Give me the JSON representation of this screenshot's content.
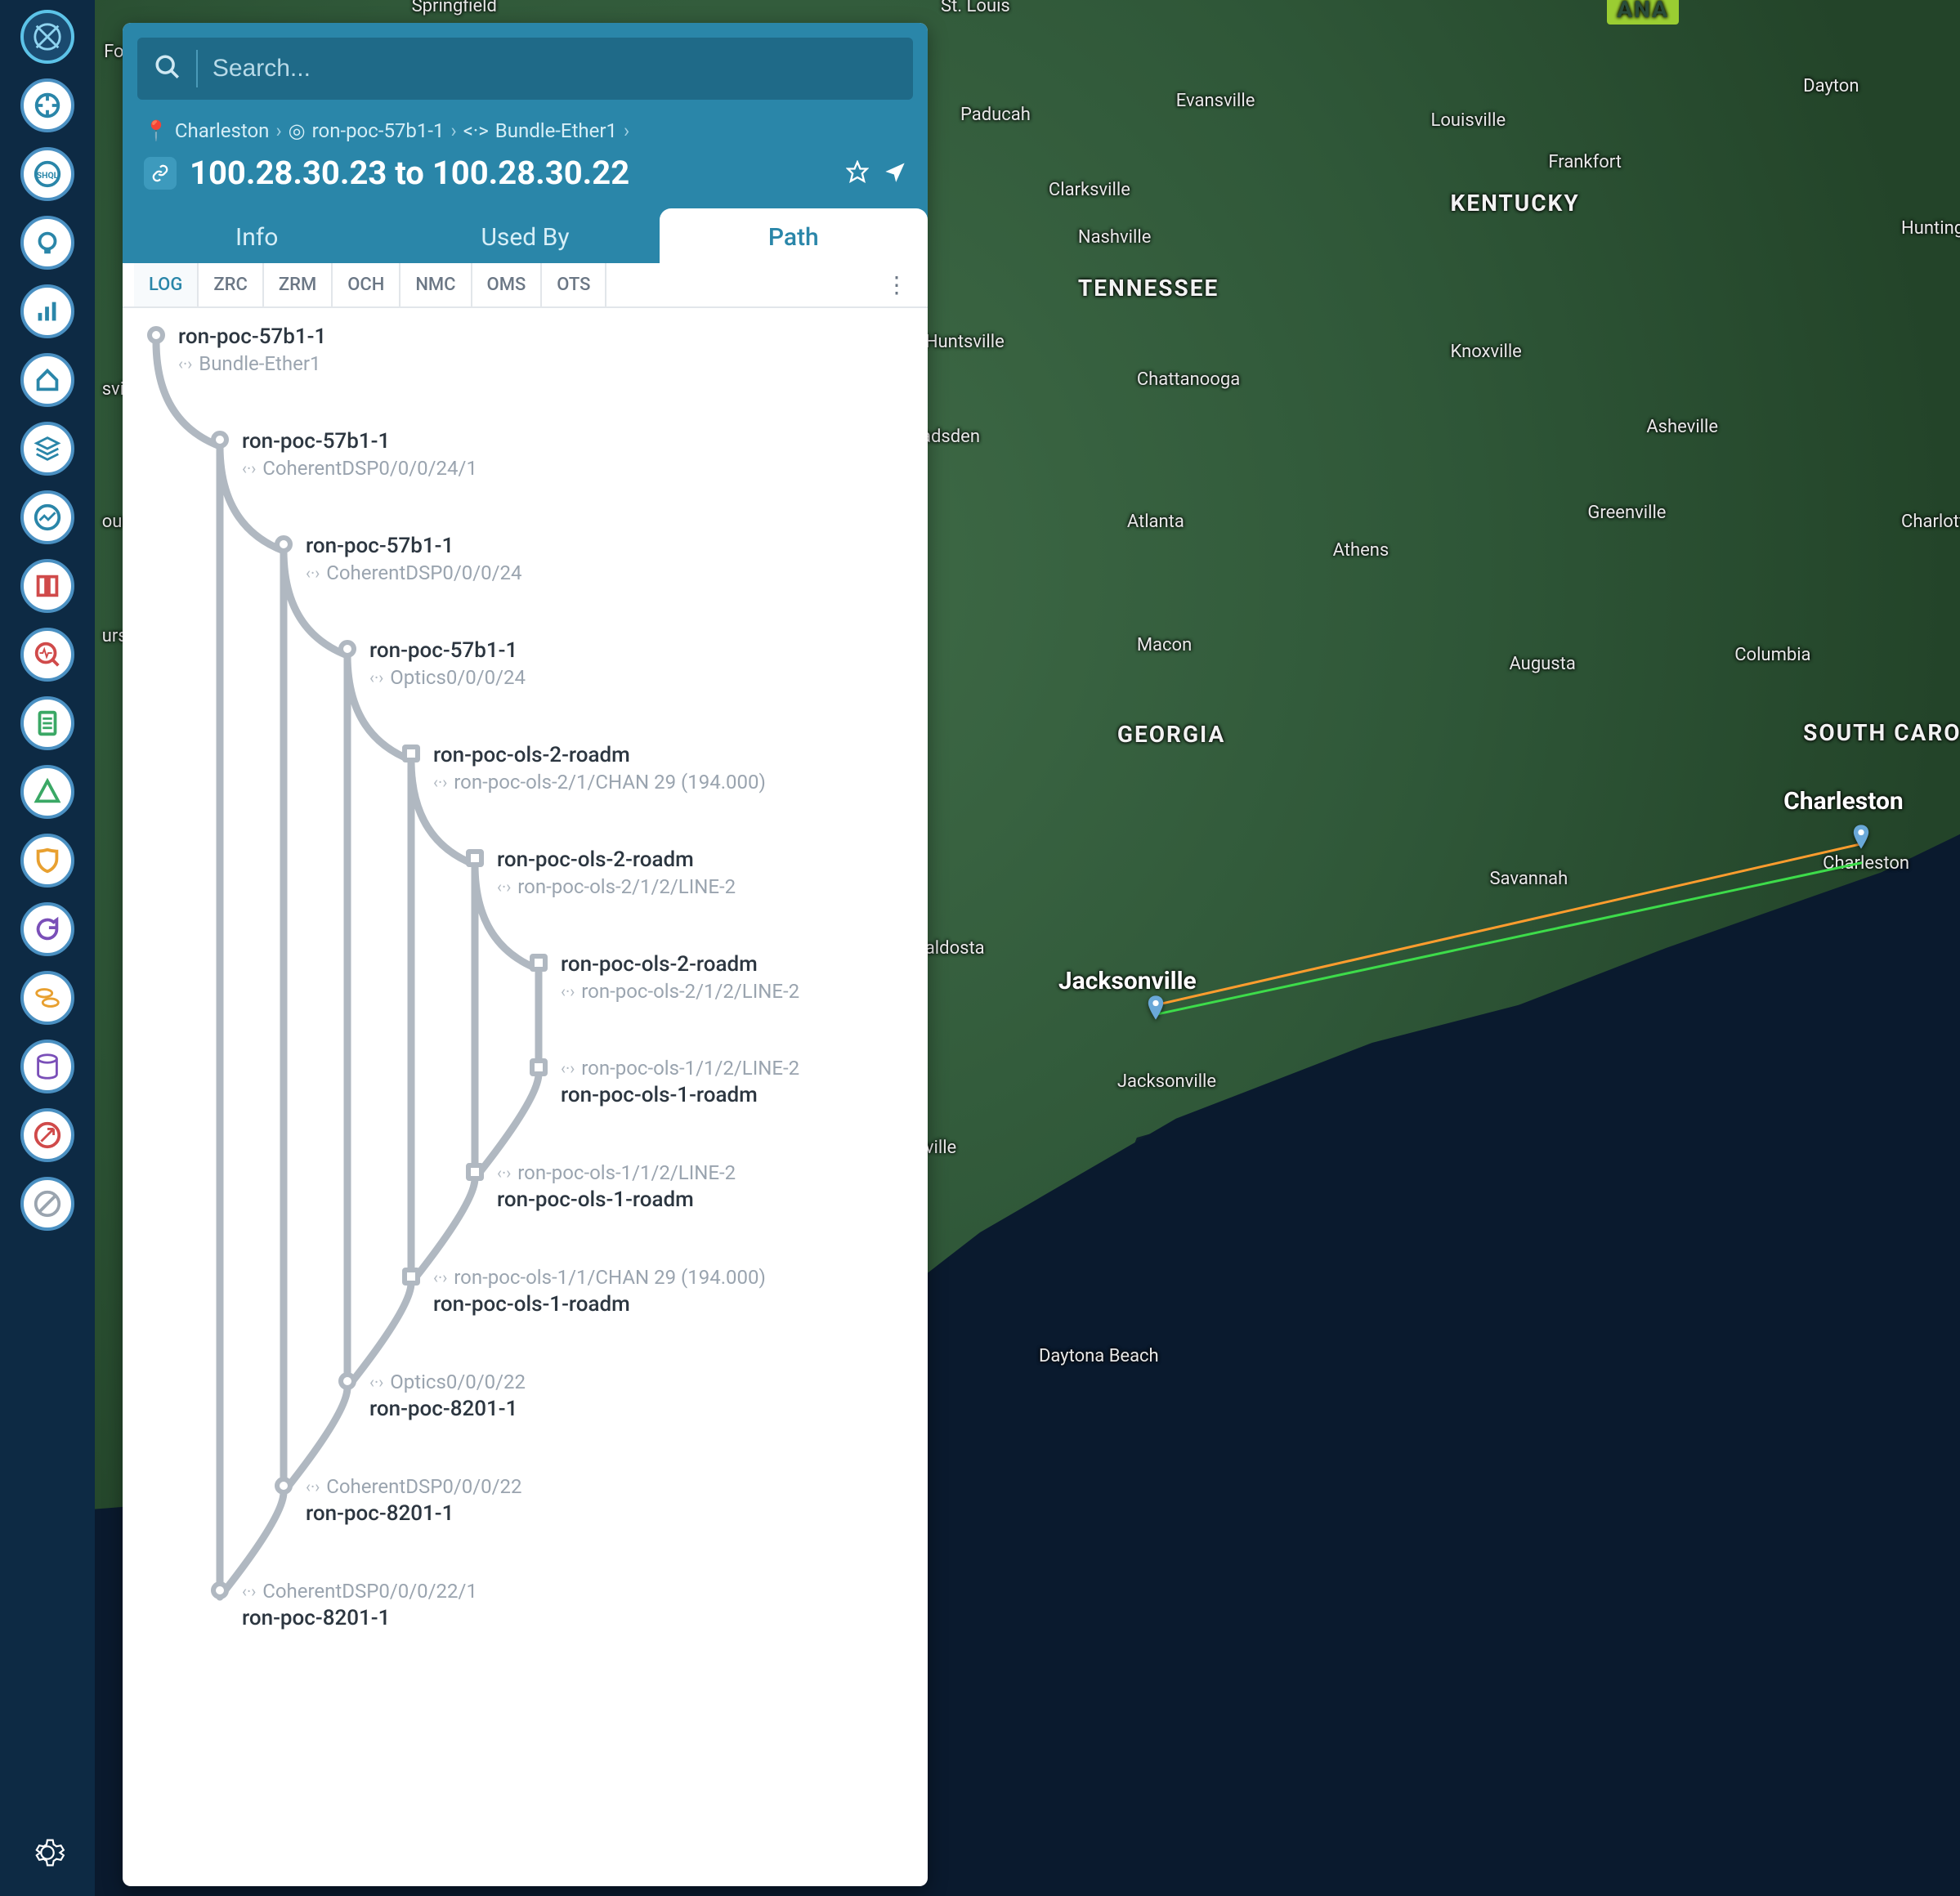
{
  "search": {
    "placeholder": "Search..."
  },
  "breadcrumb": {
    "loc": "Charleston",
    "node": "ron-poc-57b1-1",
    "iface": "Bundle-Ether1"
  },
  "title": "100.28.30.23 to 100.28.30.22",
  "tabs": {
    "info": "Info",
    "usedby": "Used By",
    "path": "Path"
  },
  "subtabs": [
    "LOG",
    "ZRC",
    "ZRM",
    "OCH",
    "NMC",
    "OMS",
    "OTS"
  ],
  "hops": [
    {
      "indent": 0,
      "shape": "circle",
      "name": "ron-poc-57b1-1",
      "sub": "Bundle-Ether1",
      "subPos": "below"
    },
    {
      "indent": 1,
      "shape": "circle",
      "name": "ron-poc-57b1-1",
      "sub": "CoherentDSP0/0/0/24/1",
      "subPos": "below"
    },
    {
      "indent": 2,
      "shape": "circle",
      "name": "ron-poc-57b1-1",
      "sub": "CoherentDSP0/0/0/24",
      "subPos": "below"
    },
    {
      "indent": 3,
      "shape": "circle",
      "name": "ron-poc-57b1-1",
      "sub": "Optics0/0/0/24",
      "subPos": "below"
    },
    {
      "indent": 4,
      "shape": "square",
      "name": "ron-poc-ols-2-roadm",
      "sub": "ron-poc-ols-2/1/CHAN 29 (194.000)",
      "subPos": "below"
    },
    {
      "indent": 5,
      "shape": "square",
      "name": "ron-poc-ols-2-roadm",
      "sub": "ron-poc-ols-2/1/2/LINE-2",
      "subPos": "below"
    },
    {
      "indent": 6,
      "shape": "square",
      "name": "ron-poc-ols-2-roadm",
      "sub": "ron-poc-ols-2/1/2/LINE-2",
      "subPos": "below"
    },
    {
      "indent": 6,
      "shape": "square",
      "name": "ron-poc-ols-1-roadm",
      "sub": "ron-poc-ols-1/1/2/LINE-2",
      "subPos": "above"
    },
    {
      "indent": 5,
      "shape": "square",
      "name": "ron-poc-ols-1-roadm",
      "sub": "ron-poc-ols-1/1/2/LINE-2",
      "subPos": "above"
    },
    {
      "indent": 4,
      "shape": "square",
      "name": "ron-poc-ols-1-roadm",
      "sub": "ron-poc-ols-1/1/CHAN 29 (194.000)",
      "subPos": "above"
    },
    {
      "indent": 3,
      "shape": "circle",
      "name": "ron-poc-8201-1",
      "sub": "Optics0/0/0/22",
      "subPos": "above"
    },
    {
      "indent": 2,
      "shape": "circle",
      "name": "ron-poc-8201-1",
      "sub": "CoherentDSP0/0/0/22",
      "subPos": "above"
    },
    {
      "indent": 1,
      "shape": "circle",
      "name": "ron-poc-8201-1",
      "sub": "CoherentDSP0/0/0/22/1",
      "subPos": "above"
    }
  ],
  "map": {
    "states": {
      "kentucky": "KENTUCKY",
      "tennessee": "TENNESSEE",
      "georgia": "GEORGIA",
      "scarolina": "SOUTH CAROLINA",
      "ana": "ANA"
    },
    "cities": {
      "springfield": "Springfield",
      "stlouis": "St. Louis",
      "fort": "Fort",
      "paducah": "Paducah",
      "evansville": "Evansville",
      "louisville": "Louisville",
      "frankfort": "Frankfort",
      "dayton": "Dayton",
      "huntington": "Huntington",
      "clarksville": "Clarksville",
      "nashville": "Nashville",
      "knoxville": "Knoxville",
      "chattanooga": "Chattanooga",
      "asheville": "Asheville",
      "greenville": "Greenville",
      "charlotte": "Charlotte",
      "columbia": "Columbia",
      "augusta": "Augusta",
      "atlanta": "Atlanta",
      "athens": "Athens",
      "macon": "Macon",
      "savannah": "Savannah",
      "charleston_s": "Charleston",
      "valdosta": "aldosta",
      "jacksonville_s": "Jacksonville",
      "daytona": "Daytona Beach",
      "gainesville": "ursville",
      "sville": "sville",
      "adsden": "adsden",
      "ourg": "ourg",
      "huntsville": "Huntsville",
      "ville": "ville"
    },
    "pins": {
      "charleston": "Charleston",
      "jacksonville": "Jacksonville"
    }
  }
}
